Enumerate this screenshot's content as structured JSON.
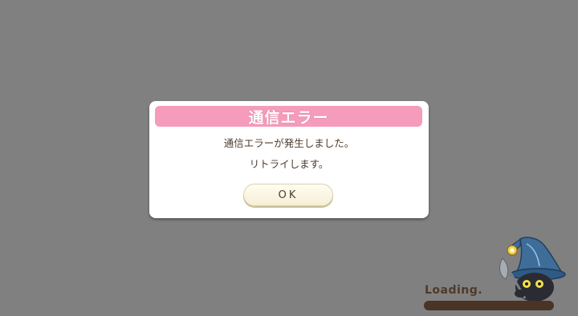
{
  "dialog": {
    "title": "通信エラー",
    "message_line1": "通信エラーが発生しました。",
    "message_line2": "リトライします。",
    "ok_label": "OK"
  },
  "loading": {
    "label": "Loading.",
    "progress": 0.0
  },
  "colors": {
    "background": "#808080",
    "header_pink": "#f59bbb",
    "text_brown": "#4d3b2c",
    "button_cream": "#fffdf2"
  },
  "icons": {
    "mascot": "black-cat-mage-icon"
  }
}
